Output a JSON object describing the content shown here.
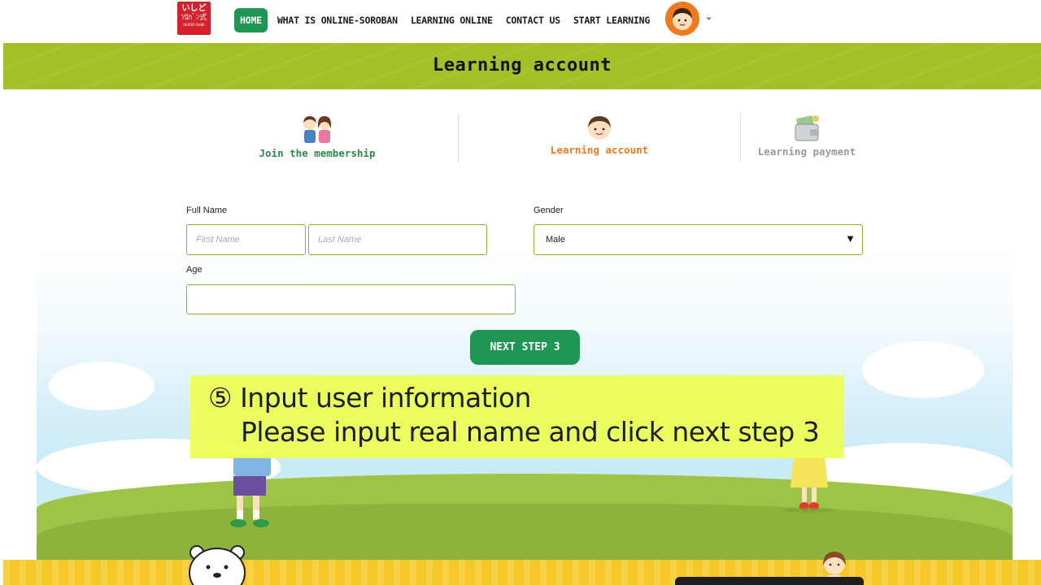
{
  "header": {
    "logo": {
      "line1": "いしど",
      "line2": "ｿﾛﾊﾞﾝ式",
      "line3": "ISHIDO-SHIKI"
    },
    "nav": [
      {
        "label": "HOME",
        "active": true
      },
      {
        "label": "WHAT IS ONLINE-SOROBAN"
      },
      {
        "label": "LEARNING ONLINE"
      },
      {
        "label": "CONTACT US"
      },
      {
        "label": "START LEARNING"
      }
    ],
    "avatar_icon": "user-avatar-icon",
    "dropdown_icon": "chevron-down-icon"
  },
  "banner": {
    "title": "Learning account"
  },
  "steps": [
    {
      "label": "Join the membership",
      "icon": "kids-icon",
      "color": "#2a8a4a"
    },
    {
      "label": "Learning account",
      "icon": "boy-face-icon",
      "color": "#ef7b1e"
    },
    {
      "label": "Learning payment",
      "icon": "wallet-icon",
      "color": "#9a9a9a"
    }
  ],
  "form": {
    "full_name_label": "Full Name",
    "first_name_placeholder": "First Name",
    "last_name_placeholder": "Last Name",
    "gender_label": "Gender",
    "gender_value": "Male",
    "age_label": "Age",
    "age_value": "",
    "next_button": "NEXT STEP 3"
  },
  "callout": {
    "line1": "⑤ Input user information",
    "line2": "Please input real name and click next step 3"
  },
  "colors": {
    "brand_green": "#1f9654",
    "banner_green": "#a3c126",
    "accent_orange": "#ef7b1e",
    "highlight": "#eeff55"
  }
}
